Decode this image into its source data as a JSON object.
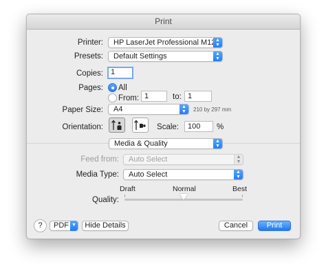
{
  "window": {
    "title": "Print"
  },
  "printer": {
    "label": "Printer:",
    "value": "HP LaserJet Professional M1212..."
  },
  "presets": {
    "label": "Presets:",
    "value": "Default Settings"
  },
  "copies": {
    "label": "Copies:",
    "value": "1"
  },
  "pages": {
    "label": "Pages:",
    "all_label": "All",
    "from_label": "From:",
    "from_value": "1",
    "to_label": "to:",
    "to_value": "1",
    "selected": "All"
  },
  "paper_size": {
    "label": "Paper Size:",
    "value": "A4",
    "dimensions": "210 by 297 mm"
  },
  "orientation": {
    "label": "Orientation:",
    "selected": "portrait"
  },
  "scale": {
    "label": "Scale:",
    "value": "100",
    "unit": "%"
  },
  "section_popup": {
    "value": "Media & Quality"
  },
  "feed_from": {
    "label": "Feed from:",
    "value": "Auto Select",
    "enabled": false
  },
  "media_type": {
    "label": "Media Type:",
    "value": "Auto Select"
  },
  "quality": {
    "label": "Quality:",
    "min_label": "Draft",
    "mid_label": "Normal",
    "max_label": "Best",
    "level": 0.5
  },
  "bottom": {
    "help": "?",
    "pdf_label": "PDF",
    "hide_details_label": "Hide Details",
    "cancel_label": "Cancel",
    "print_label": "Print"
  },
  "colors": {
    "accent": "#1a7af8",
    "window_bg": "#ececec"
  }
}
